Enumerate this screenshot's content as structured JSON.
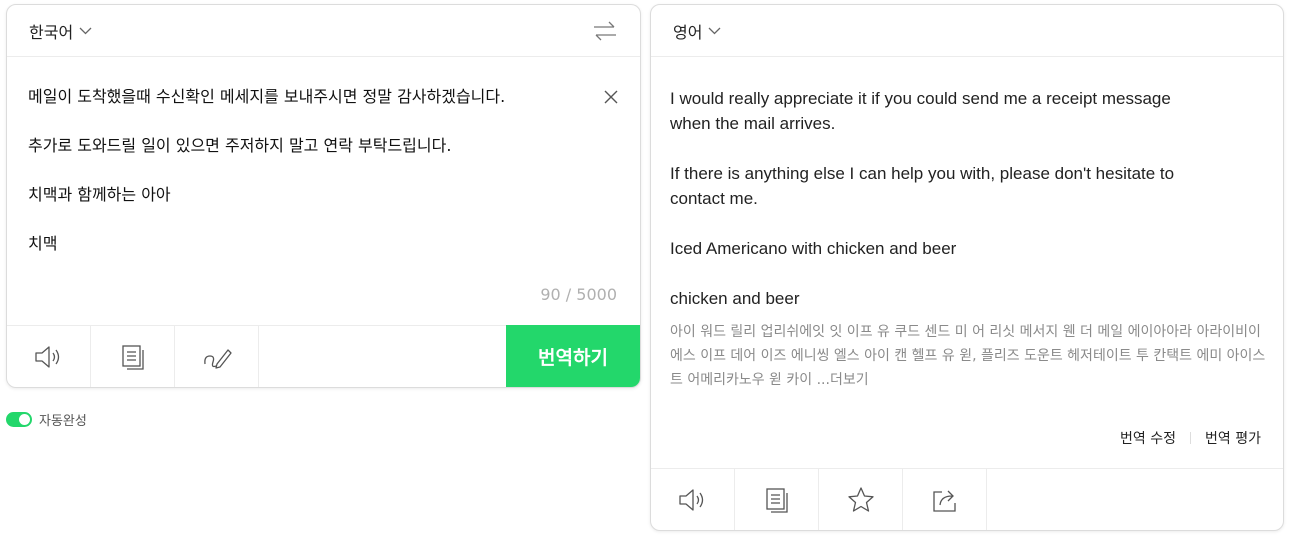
{
  "source": {
    "language": "한국어",
    "text": "메일이 도착했을때 수신확인 메세지를 보내주시면 정말 감사하겠습니다.\n\n추가로 도와드릴 일이 있으면 주저하지 말고 연락 부탁드립니다.\n\n치맥과 함께하는 아아\n\n치맥",
    "char_count": "90 / 5000",
    "translate_label": "번역하기",
    "icons": [
      "speaker-icon",
      "copy-icon",
      "handwriting-icon"
    ]
  },
  "autocomplete": {
    "label": "자동완성",
    "enabled": true
  },
  "target": {
    "language": "영어",
    "text": "I would really appreciate it if you could send me a receipt message\nwhen the mail arrives.\n\nIf there is anything else I can help you with, please don't hesitate to\ncontact me.\n\nIced Americano with chicken and beer\n\nchicken and beer",
    "pronunciation": "아이 워드 릴리 업리쉬에잇 잇 이프 유 쿠드 센드 미 어 리싯 메서지 웬 더 메일 에이아아라 아라이비이에스 이프 데어 이즈 에니씽 엘스 아이 캔 헬프 유 윋, 플리즈 도운트 헤저테이트 투 칸택트 에미 아이스트 어메리카노우 윋 카이 ",
    "more_label": "...더보기",
    "edit_label": "번역 수정",
    "rate_label": "번역 평가",
    "icons": [
      "speaker-icon",
      "copy-icon",
      "star-icon",
      "share-icon"
    ]
  },
  "colors": {
    "accent": "#23d76b"
  }
}
